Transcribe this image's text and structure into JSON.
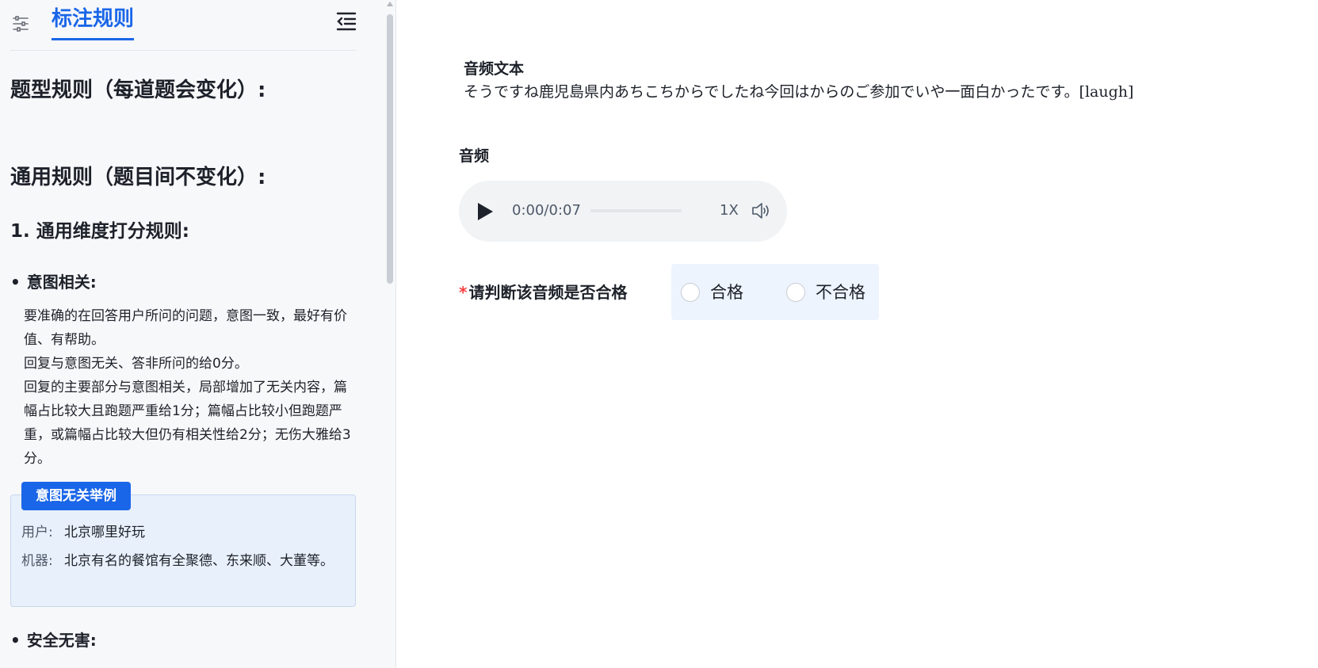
{
  "sidebar": {
    "title": "标注规则",
    "type_rules_heading": "题型规则（每道题会变化）:",
    "general_rules_heading": "通用规则（题目间不变化）:",
    "dimension_heading": "1. 通用维度打分规则:",
    "intent": {
      "title": "意图相关:",
      "paragraphs": [
        "要准确的在回答用户所问的问题，意图一致，最好有价值、有帮助。",
        "回复与意图无关、答非所问的给0分。",
        "回复的主要部分与意图相关，局部增加了无关内容，篇幅占比较大且跑题严重给1分；篇幅占比较小但跑题严重，或篇幅占比较大但仍有相关性给2分；无伤大雅给3分。"
      ],
      "example": {
        "tag": "意图无关举例",
        "user_label": "用户:",
        "user_text": "北京哪里好玩",
        "bot_label": "机器:",
        "bot_text": "北京有名的餐馆有全聚德、东来顺、大董等。"
      }
    },
    "safety": {
      "title": "安全无害:"
    },
    "icons": {
      "filter": "filter-settings-icon",
      "collapse": "collapse-sidebar-icon"
    }
  },
  "main": {
    "text_label": "音频文本",
    "text_content": "そうですね鹿児島県内あちこちからでしたね今回はからのご参加でいや一面白かったです。[laugh]",
    "audio_label": "音频",
    "player": {
      "time": "0:00/0:07",
      "progress": 0,
      "speed": "1X"
    },
    "question": {
      "required_mark": "*",
      "label": "请判断该音频是否合格",
      "options": [
        "合格",
        "不合格"
      ]
    }
  },
  "colors": {
    "accent": "#1a66e8",
    "required": "#f53f3f",
    "sidebar_bg": "#f7f8fa",
    "example_bg": "#e8f0fb",
    "options_bg": "#eef4fe"
  }
}
